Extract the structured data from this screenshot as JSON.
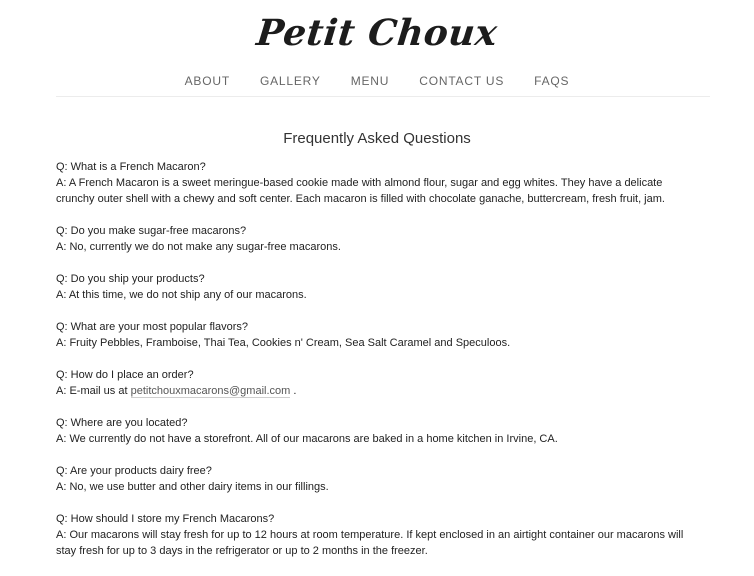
{
  "site": {
    "logo": "Petit Choux"
  },
  "nav": [
    {
      "label": "ABOUT"
    },
    {
      "label": "GALLERY"
    },
    {
      "label": "MENU"
    },
    {
      "label": "CONTACT US"
    },
    {
      "label": "FAQS"
    }
  ],
  "page": {
    "title": "Frequently Asked Questions"
  },
  "faq": [
    {
      "q": "Q:  What is a French Macaron?",
      "a": "A:  A French Macaron is a sweet meringue-based cookie made with almond flour, sugar and egg whites.  They have a delicate crunchy outer shell with a chewy and soft center.  Each macaron is filled with chocolate ganache, buttercream, fresh fruit, jam."
    },
    {
      "q": "Q:  Do you make sugar-free macarons?",
      "a": "A:  No, currently we do not make any sugar-free macarons."
    },
    {
      "q": "Q:  Do you ship your products?",
      "a": "A:  At this time, we do not ship any of our macarons."
    },
    {
      "q": "Q: What are your most popular flavors?",
      "a": "A: Fruity Pebbles, Framboise, Thai Tea, Cookies n' Cream, Sea Salt Caramel and Speculoos."
    },
    {
      "q": "Q:  How do I place an order?",
      "a_prefix": "A:  E-mail us at ",
      "a_link": "petitchouxmacarons@gmail.com",
      "a_suffix": " ."
    },
    {
      "q": "Q: Where are you located?",
      "a": "A: We currently do not have a storefront.  All of our macarons are baked in a home kitchen in Irvine, CA."
    },
    {
      "q": "Q:  Are your products dairy free?",
      "a": "A:  No, we use butter and other dairy items in our fillings."
    },
    {
      "q": "Q:  How should I store my French Macarons?",
      "a": "A:  Our macarons will stay fresh for up to 12 hours at room temperature.  If kept enclosed in an airtight container our macarons will stay fresh for up to 3 days in the refrigerator or up to 2 months in the freezer."
    }
  ]
}
